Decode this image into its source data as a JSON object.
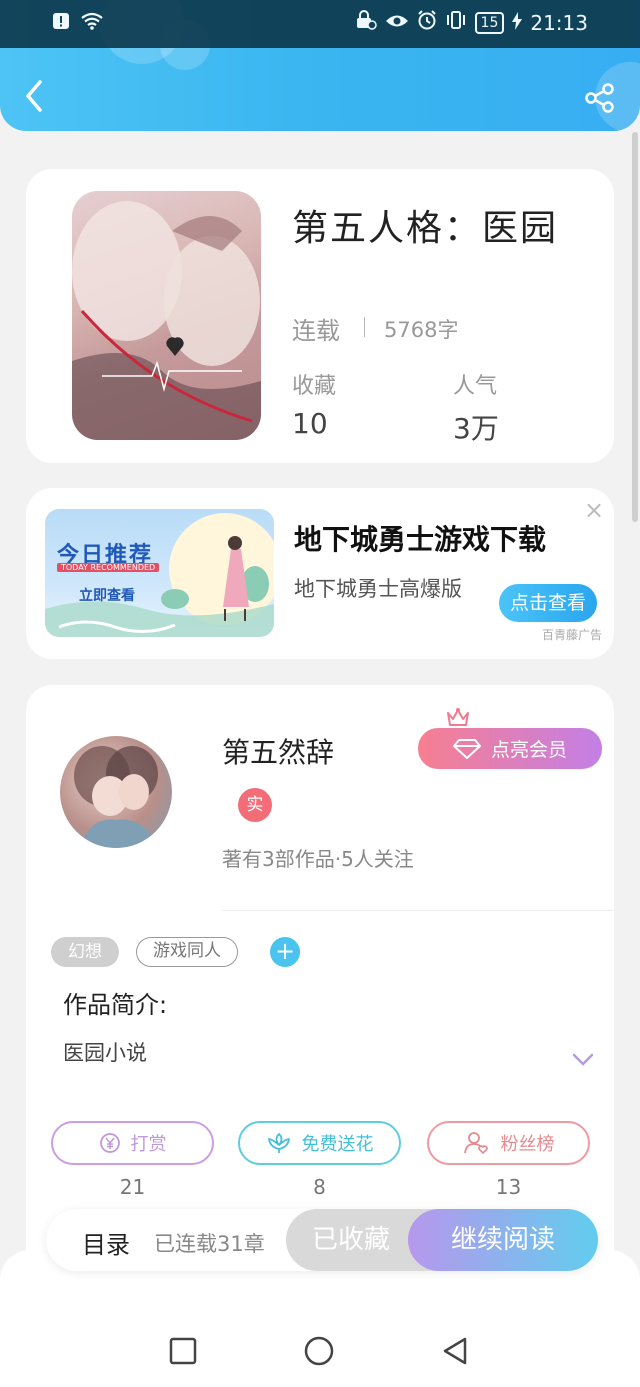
{
  "status_bar": {
    "time": "21:13",
    "battery": "15"
  },
  "book": {
    "title": "第五人格：医园",
    "status": "连载",
    "words": "5768字",
    "fav_label": "收藏",
    "fav_value": "10",
    "pop_label": "人气",
    "pop_value": "3万"
  },
  "ad": {
    "title": "地下城勇士游戏下载",
    "subtitle": "地下城勇士高爆版",
    "button": "点击查看",
    "source": "百青藤广告",
    "close": "×",
    "image_title": "今日推荐",
    "image_sub": "TODAY RECOMMENDED",
    "image_cta": "立即查看"
  },
  "author": {
    "name": "第五然辞",
    "vip_button": "点亮会员",
    "badge": "实",
    "stats": "著有3部作品·5人关注"
  },
  "tags": [
    "幻想",
    "游戏同人"
  ],
  "intro": {
    "heading": "作品简介:",
    "text": "医园小说"
  },
  "actions": [
    {
      "label": "打赏",
      "count": "21"
    },
    {
      "label": "免费送花",
      "count": "8"
    },
    {
      "label": "粉丝榜",
      "count": "13"
    }
  ],
  "bottom_bar": {
    "toc": "目录",
    "chapters": "已连载31章",
    "favorited": "已收藏",
    "continue": "继续阅读"
  },
  "colors": {
    "header": "#3ab5f0",
    "accent": "#4ac4f8",
    "vip": "#f77f90"
  }
}
